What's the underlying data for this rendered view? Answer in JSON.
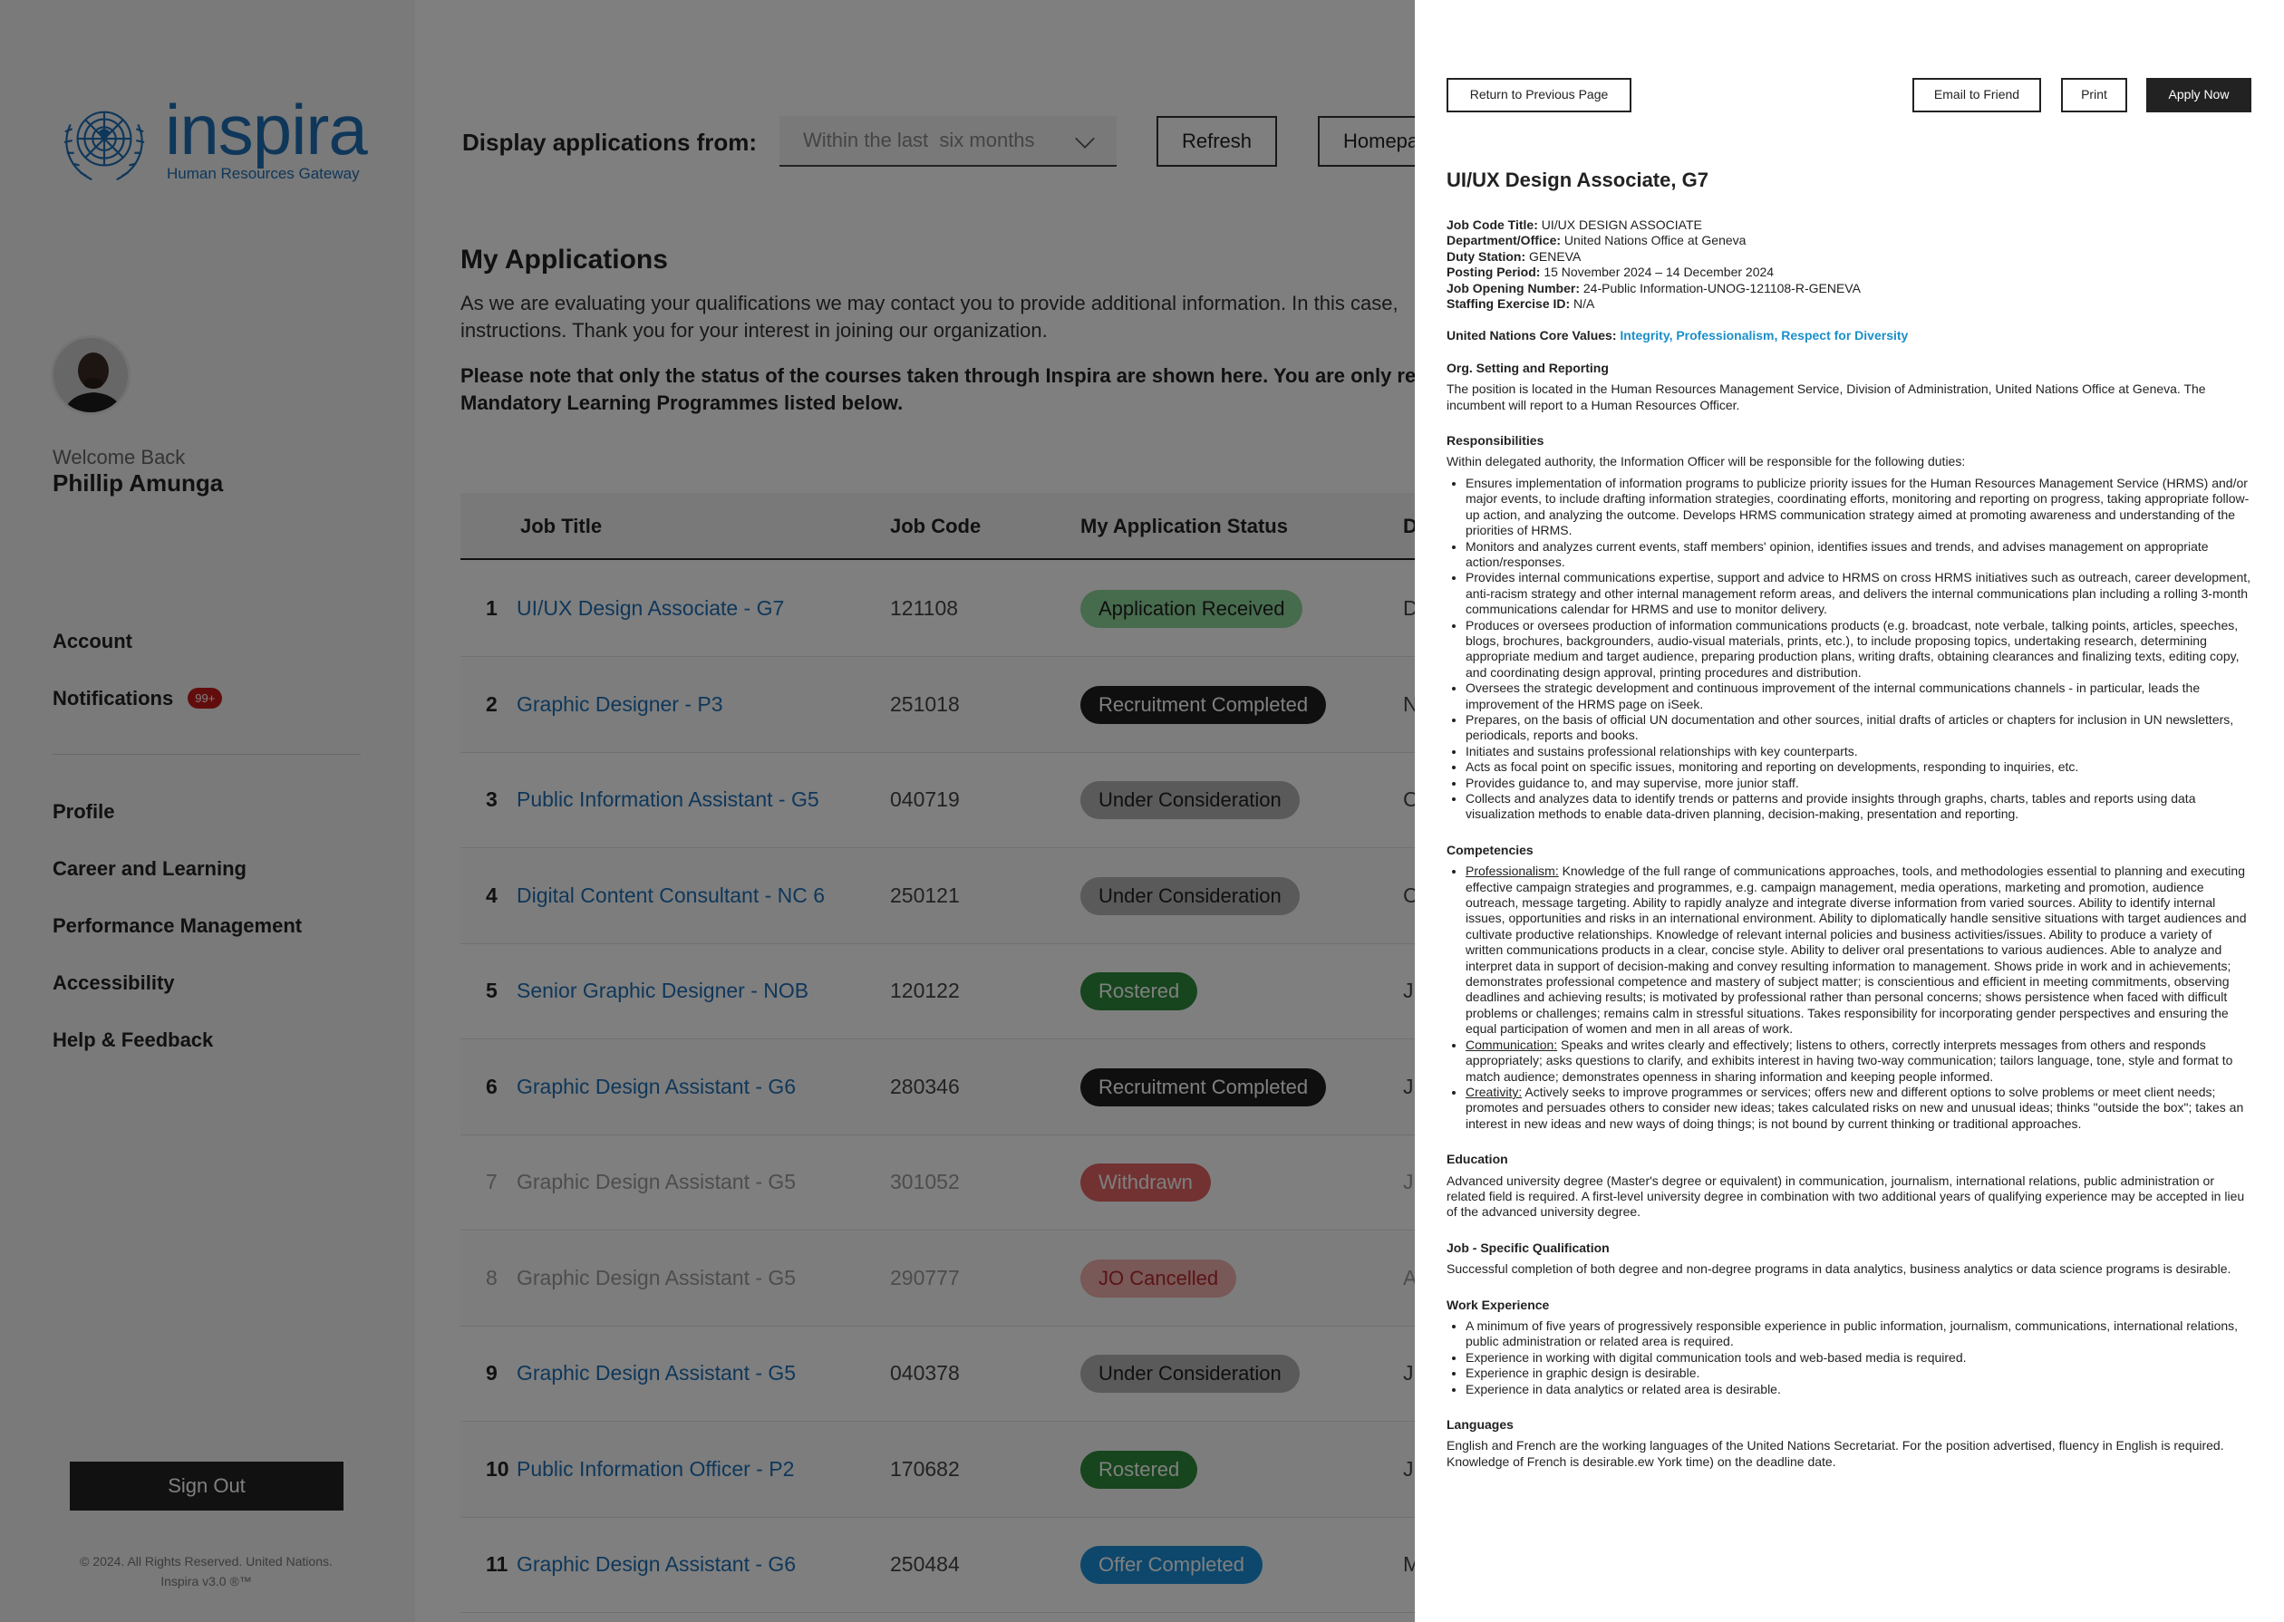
{
  "colors": {
    "brand": "#1f6fb5",
    "received": "#8fd69a",
    "recruitment_completed": "#1e1e1e",
    "under_consideration": "#b5b5b5",
    "rostered": "#2e8b3a",
    "withdrawn": "#e04a4a",
    "jo_cancelled": "#f2b1b1",
    "offer_completed": "#1a8fd9"
  },
  "sidebar": {
    "logo_word": "inspira",
    "logo_tagline": "Human Resources Gateway",
    "welcome": "Welcome Back",
    "user_name": "Phillip Amunga",
    "primary_nav": [
      {
        "label": "Account"
      },
      {
        "label": "Notifications",
        "badge": "99+"
      }
    ],
    "secondary_nav": [
      {
        "label": "Profile"
      },
      {
        "label": "Career and Learning"
      },
      {
        "label": "Performance Management"
      },
      {
        "label": "Accessibility"
      },
      {
        "label": "Help & Feedback"
      }
    ],
    "sign_out": "Sign Out",
    "copyright_line1": "© 2024. All Rights Reserved. United Nations.",
    "copyright_line2": "Inspira v3.0 ®™"
  },
  "main": {
    "filter_label": "Display applications from:",
    "filter_value": "Within the last  six months",
    "refresh": "Refresh",
    "homepage": "Homepa",
    "title": "My Applications",
    "intro": "As we are evaluating your qualifications we may contact you to provide additional information. In this case,\ninstructions. Thank you for your interest in joining our organization.",
    "notice": "Please note that only the status of the courses taken through Inspira are shown here. You are only requir\nMandatory Learning Programmes listed below.",
    "columns": {
      "job_title": "Job Title",
      "job_code": "Job Code",
      "status": "My Application Status",
      "extra": "D"
    },
    "rows": [
      {
        "num": "1",
        "title": "UI/UX Design Associate - G7",
        "code": "121108",
        "status": "Application Received",
        "extra": "D"
      },
      {
        "num": "2",
        "title": "Graphic Designer - P3",
        "code": "251018",
        "status": "Recruitment Completed",
        "extra": "N"
      },
      {
        "num": "3",
        "title": "Public Information Assistant - G5",
        "code": "040719",
        "status": "Under Consideration",
        "extra": "C"
      },
      {
        "num": "4",
        "title": "Digital Content Consultant - NC 6",
        "code": "250121",
        "status": "Under Consideration",
        "extra": "C"
      },
      {
        "num": "5",
        "title": "Senior Graphic Designer - NOB",
        "code": "120122",
        "status": "Rostered",
        "extra": "J"
      },
      {
        "num": "6",
        "title": "Graphic Design Assistant - G6",
        "code": "280346",
        "status": "Recruitment Completed",
        "extra": "J"
      },
      {
        "num": "7",
        "title": "Graphic Design Assistant - G5",
        "code": "301052",
        "status": "Withdrawn",
        "extra": "J"
      },
      {
        "num": "8",
        "title": "Graphic Design Assistant - G5",
        "code": "290777",
        "status": "JO Cancelled",
        "extra": "A"
      },
      {
        "num": "9",
        "title": "Graphic Design Assistant - G5",
        "code": "040378",
        "status": "Under Consideration",
        "extra": "J"
      },
      {
        "num": "10",
        "title": "Public Information Officer - P2",
        "code": "170682",
        "status": "Rostered",
        "extra": "J"
      },
      {
        "num": "11",
        "title": "Graphic Design Assistant - G6",
        "code": "250484",
        "status": "Offer Completed",
        "extra": "M"
      }
    ]
  },
  "panel": {
    "back": "Return to Previous Page",
    "email": "Email to Friend",
    "print": "Print",
    "apply": "Apply Now",
    "heading": "UI/UX Design Associate, G7",
    "details": [
      {
        "k": "Job Code Title:",
        "v": "UI/UX DESIGN ASSOCIATE"
      },
      {
        "k": "Department/Office:",
        "v": "United Nations Office at Geneva"
      },
      {
        "k": "Duty Station:",
        "v": "GENEVA"
      },
      {
        "k": "Posting Period:",
        "v": "15 November 2024 – 14 December 2024"
      },
      {
        "k": "Job Opening Number:",
        "v": "24-Public Information-UNOG-121108-R-GENEVA"
      },
      {
        "k": "Staffing Exercise ID:",
        "v": "N/A"
      }
    ],
    "core_values_label": "United Nations Core Values:",
    "core_values": "Integrity, Professionalism, Respect for Diversity",
    "org_title": "Org. Setting and Reporting",
    "org_text": "The position is located in the Human Resources Management Service, Division of Administration, United Nations Office at Geneva. The incumbent will report to a Human Resources Officer.",
    "resp_title": "Responsibilities",
    "resp_intro": "Within delegated authority, the Information Officer will be responsible for the following duties:",
    "resp_items": [
      "Ensures implementation of information programs to publicize priority issues for the Human Resources Management Service (HRMS) and/or major events, to include drafting information strategies, coordinating efforts, monitoring and reporting on progress, taking appropriate follow-up action, and analyzing the outcome. Develops HRMS communication strategy aimed at promoting awareness and understanding of the priorities of HRMS.",
      "Monitors and analyzes current events, staff members' opinion, identifies issues and trends, and advises management on appropriate action/responses.",
      "Provides internal communications expertise, support and advice to HRMS on cross HRMS initiatives such as outreach, career development, anti-racism strategy and other internal management reform areas, and delivers the internal communications plan including a rolling 3-month communications calendar for HRMS and use to monitor delivery.",
      "Produces or oversees production of information communications products (e.g. broadcast, note verbale, talking points, articles, speeches, blogs, brochures, backgrounders, audio-visual materials, prints, etc.), to include proposing topics, undertaking research, determining appropriate medium and target audience, preparing production plans, writing drafts, obtaining clearances and finalizing texts, editing copy, and coordinating design approval, printing procedures and distribution.",
      "Oversees the strategic development and continuous improvement of the internal communications channels - in particular, leads the improvement of the HRMS page on iSeek.",
      "Prepares, on the basis of official UN documentation and other sources, initial drafts of articles or chapters for inclusion in UN newsletters, periodicals, reports and books.",
      "Initiates and sustains professional relationships with key counterparts.",
      "Acts as focal point on specific issues, monitoring and reporting on developments, responding to inquiries, etc.",
      "Provides guidance to, and may supervise, more junior staff.",
      "Collects and analyzes data to identify trends or patterns and provide insights through graphs, charts, tables and reports using data visualization methods to enable data-driven planning, decision-making, presentation and reporting."
    ],
    "comp_title": "Competencies",
    "comp_items": [
      {
        "name": "Professionalism:",
        "text": " Knowledge of the full range of communications approaches, tools, and methodologies essential to planning and executing effective campaign strategies and programmes, e.g. campaign management, media operations, marketing and promotion, audience outreach, message targeting. Ability to rapidly analyze and integrate diverse information from varied sources. Ability to identify internal issues, opportunities and risks in an international environment. Ability to diplomatically handle sensitive situations with target audiences and cultivate productive relationships. Knowledge of relevant internal policies and business activities/issues.  Ability to produce a variety of written communications products in a clear, concise style. Ability to deliver oral presentations to various audiences. Able to analyze and interpret data in support of decision-making and convey resulting information to management. Shows pride in work and in achievements; demonstrates professional competence and mastery of subject matter; is conscientious and efficient in meeting commitments, observing deadlines and achieving results; is motivated by professional rather than personal concerns; shows persistence when faced with difficult problems or challenges; remains calm in stressful situations. Takes responsibility for incorporating gender perspectives and ensuring the equal participation of women and men in all areas of work."
      },
      {
        "name": "Communication:",
        "text": "  Speaks and writes clearly and effectively; listens to others, correctly interprets messages from others and responds appropriately; asks questions to clarify, and exhibits interest in having two-way communication; tailors language, tone, style and format to match audience; demonstrates openness in sharing information and keeping people informed."
      },
      {
        "name": "Creativity:",
        "text": " Actively seeks to improve programmes or services; offers new and different options to solve problems or meet client needs; promotes and persuades others to consider new ideas; takes calculated risks on new and unusual ideas; thinks \"outside the box\"; takes an interest in new ideas and new ways of doing things; is not bound by current thinking or traditional approaches."
      }
    ],
    "edu_title": "Education",
    "edu_text": "Advanced university degree (Master's degree or equivalent) in communication, journalism, international relations, public administration or related field is required. A first-level university degree in combination with two additional years of qualifying experience may be accepted in lieu of the advanced university degree.",
    "jsq_title": "Job - Specific Qualification",
    "jsq_text": "Successful completion of both degree and non-degree programs in data analytics, business analytics or data science programs is desirable.",
    "work_title": "Work Experience",
    "work_items": [
      "A minimum of five years of progressively responsible experience in public information, journalism, communications, international relations, public administration or related area is required.",
      "Experience in working with digital communication tools and web-based media is required.",
      "Experience in graphic design is desirable.",
      "Experience in data analytics or related area is desirable."
    ],
    "lang_title": "Languages",
    "lang_text": "English and French are the working languages of the United Nations Secretariat. For the position advertised, fluency in English is required. Knowledge of French is desirable.ew York time) on the deadline date."
  }
}
